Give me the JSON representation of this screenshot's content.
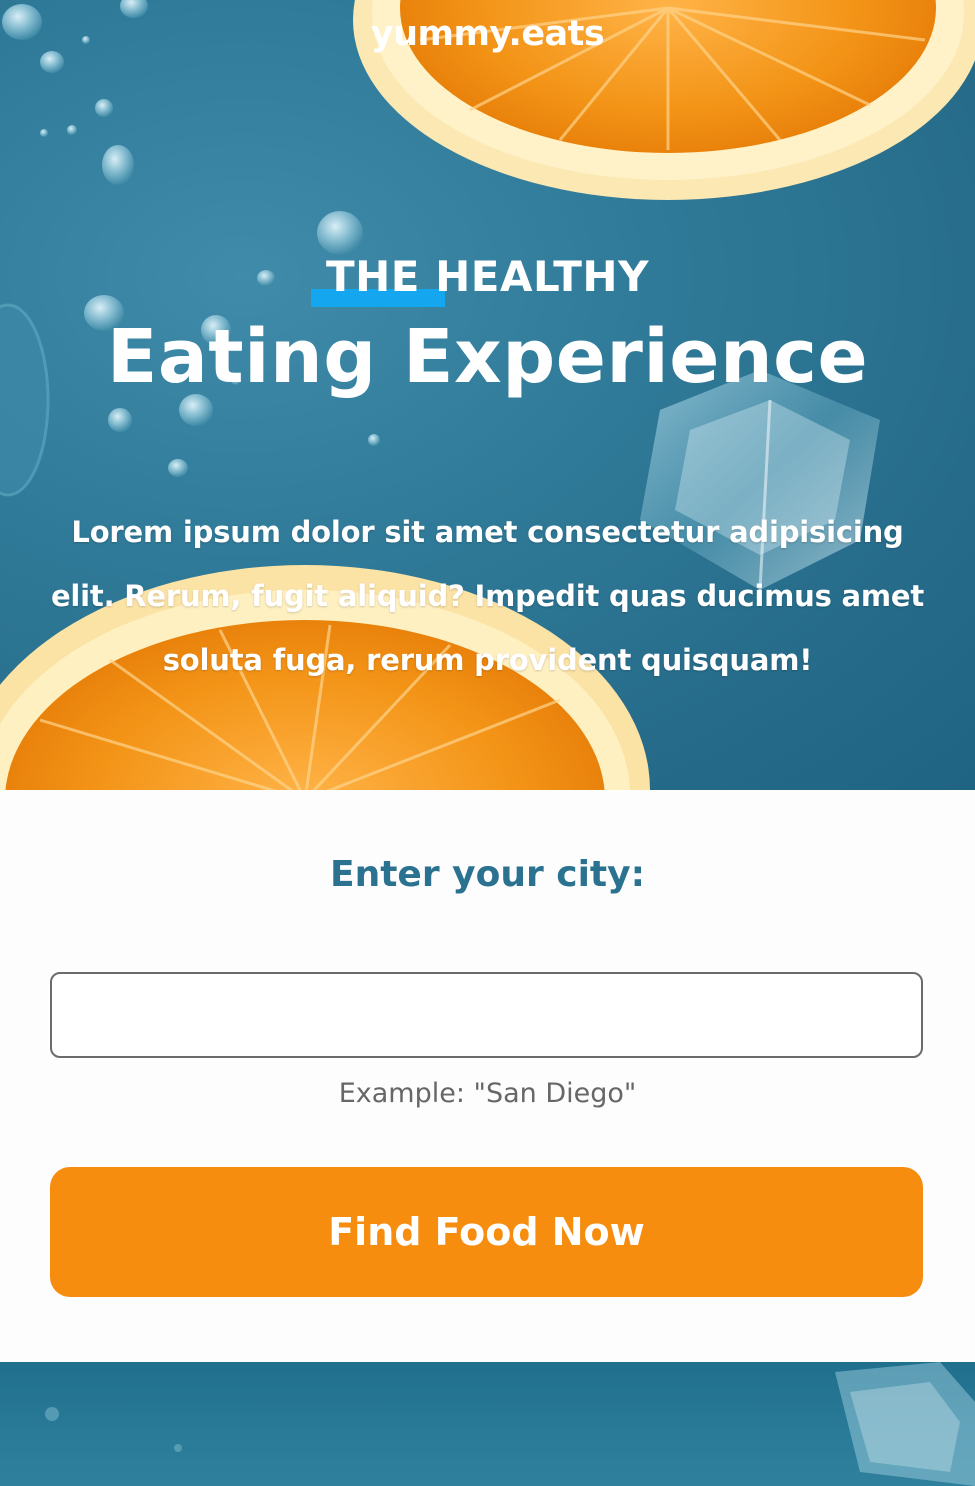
{
  "brand": {
    "name": "yummy.eats"
  },
  "hero": {
    "kicker": "THE HEALTHY",
    "headline": "Eating Experience",
    "paragraph": "Lorem ipsum dolor sit amet consectetur adipisicing elit. Rerum, fugit aliquid? Impedit quas ducimus amet soluta fuga, rerum provident quisquam!",
    "image_subject": "orange-slices-on-water-photo"
  },
  "form": {
    "heading": "Enter your city:",
    "city_value": "",
    "hint": "Example: \"San Diego\"",
    "submit_label": "Find Food Now"
  },
  "colors": {
    "accent_orange": "#f68d0e",
    "heading_teal": "#2b7290",
    "underline_blue": "#14a7f0",
    "hero_blue": "#2f7a98"
  }
}
